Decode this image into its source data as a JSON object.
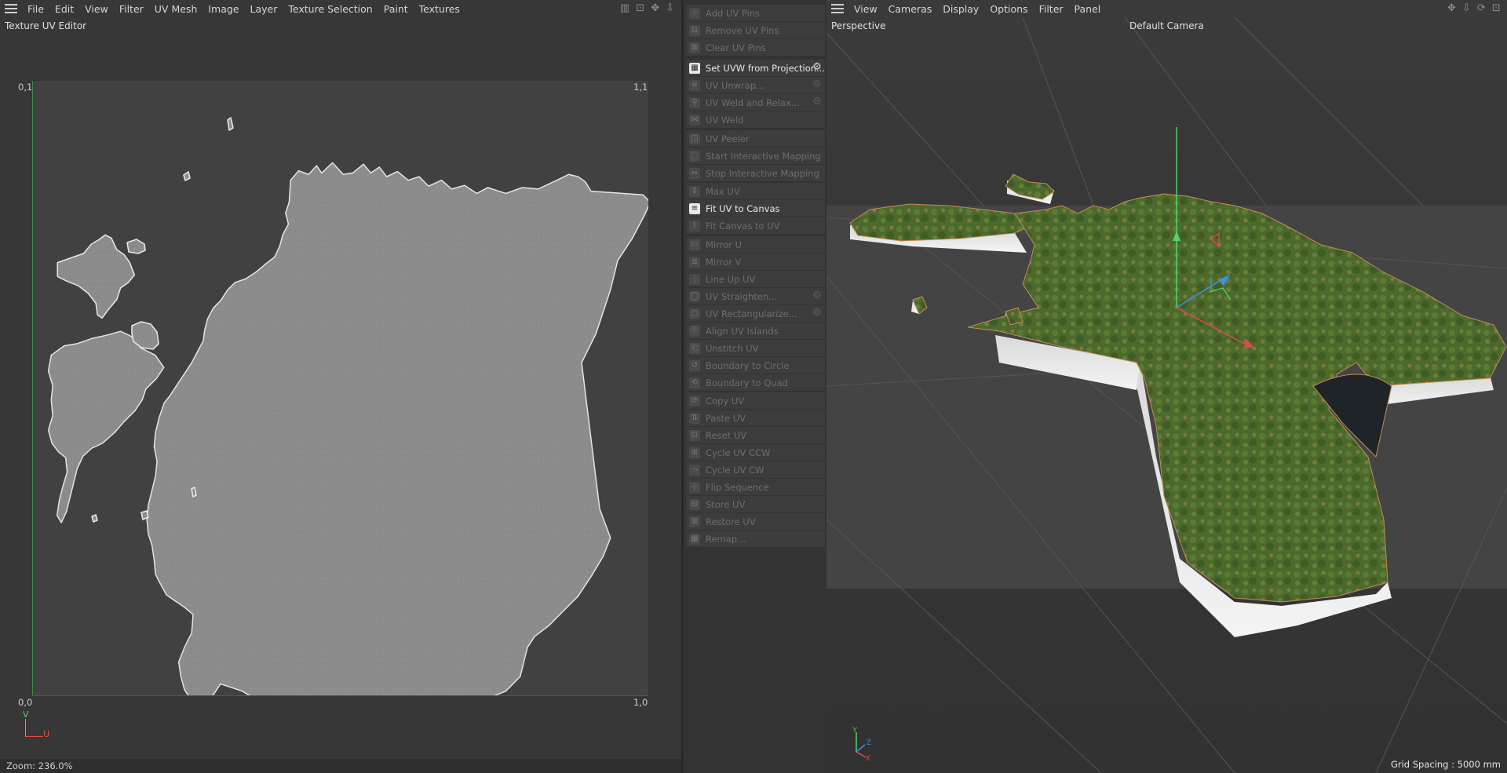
{
  "uv_editor": {
    "menu": [
      "File",
      "Edit",
      "View",
      "Filter",
      "UV Mesh",
      "Image",
      "Layer",
      "Texture Selection",
      "Paint",
      "Textures"
    ],
    "title": "Texture UV Editor",
    "corners": {
      "top_left": "0,1",
      "top_right": "1,1",
      "bottom_left": "0,0",
      "bottom_right": "1,0"
    },
    "axis_v": "V",
    "axis_u": "U",
    "status": "Zoom: 236.0%",
    "toolbar_icons": [
      "stats-icon",
      "lock-icon",
      "move-icon",
      "pan-icon"
    ]
  },
  "commands": {
    "groups": [
      [
        {
          "label": "Add UV Pins",
          "enabled": false,
          "gear": false
        },
        {
          "label": "Remove UV Pins",
          "enabled": false,
          "gear": false
        },
        {
          "label": "Clear UV Pins",
          "enabled": false,
          "gear": false
        }
      ],
      [
        {
          "label": "Set UVW from Projection...",
          "enabled": true,
          "gear": true
        },
        {
          "label": "UV Unwrap...",
          "enabled": false,
          "gear": true
        },
        {
          "label": "UV Weld and Relax...",
          "enabled": false,
          "gear": true
        },
        {
          "label": "UV Weld",
          "enabled": false,
          "gear": false
        }
      ],
      [
        {
          "label": "UV Peeler",
          "enabled": false,
          "gear": false
        },
        {
          "label": "Start Interactive Mapping",
          "enabled": false,
          "gear": false
        },
        {
          "label": "Stop Interactive Mapping",
          "enabled": false,
          "gear": false
        }
      ],
      [
        {
          "label": "Max UV",
          "enabled": false,
          "gear": false
        },
        {
          "label": "Fit UV to Canvas",
          "enabled": true,
          "gear": false
        },
        {
          "label": "Fit Canvas to UV",
          "enabled": false,
          "gear": false
        }
      ],
      [
        {
          "label": "Mirror U",
          "enabled": false,
          "gear": false
        },
        {
          "label": "Mirror V",
          "enabled": false,
          "gear": false
        },
        {
          "label": "Line Up UV",
          "enabled": false,
          "gear": false
        },
        {
          "label": "UV Straighten...",
          "enabled": false,
          "gear": true
        },
        {
          "label": "UV Rectangularize...",
          "enabled": false,
          "gear": true
        },
        {
          "label": "Align UV Islands",
          "enabled": false,
          "gear": false
        },
        {
          "label": "Unstitch UV",
          "enabled": false,
          "gear": false
        },
        {
          "label": "Boundary to Circle",
          "enabled": false,
          "gear": false
        },
        {
          "label": "Boundary to Quad",
          "enabled": false,
          "gear": false
        }
      ],
      [
        {
          "label": "Copy UV",
          "enabled": false,
          "gear": false
        },
        {
          "label": "Paste UV",
          "enabled": false,
          "gear": false
        },
        {
          "label": "Reset UV",
          "enabled": false,
          "gear": false
        },
        {
          "label": "Cycle UV CCW",
          "enabled": false,
          "gear": false
        },
        {
          "label": "Cycle UV CW",
          "enabled": false,
          "gear": false
        },
        {
          "label": "Flip Sequence",
          "enabled": false,
          "gear": false
        },
        {
          "label": "Store UV",
          "enabled": false,
          "gear": false
        },
        {
          "label": "Restore UV",
          "enabled": false,
          "gear": false
        },
        {
          "label": "Remap...",
          "enabled": false,
          "gear": false
        }
      ]
    ]
  },
  "viewport": {
    "menu": [
      "View",
      "Cameras",
      "Display",
      "Options",
      "Filter",
      "Panel"
    ],
    "title": "Perspective",
    "camera": "Default Camera",
    "grid_spacing": "Grid Spacing : 5000 mm",
    "gizmo": {
      "y": "Y",
      "z": "Z",
      "x": "X"
    },
    "toolbar_icons": [
      "move-icon",
      "pan-icon",
      "rotate-icon",
      "maximize-icon"
    ]
  },
  "colors": {
    "uv_outline": "#e6e6e6",
    "uv_fill": "#8c8c8c",
    "axis_green": "#4fd26a",
    "axis_red": "#e24a4a",
    "axis_blue": "#3b8fe8",
    "terrain": "#4d6b2e"
  }
}
